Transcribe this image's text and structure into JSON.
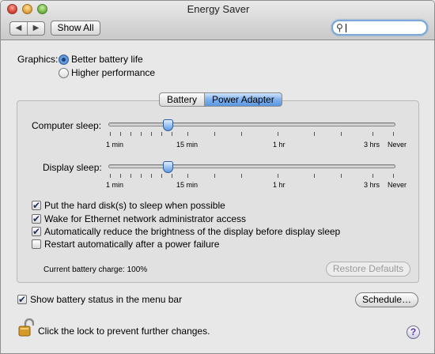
{
  "window": {
    "title": "Energy Saver"
  },
  "toolbar": {
    "back_icon": "back-arrow-icon",
    "forward_icon": "forward-arrow-icon",
    "back_glyph": "◀",
    "forward_glyph": "▶",
    "show_all_label": "Show All",
    "search_placeholder": "",
    "search_value": "",
    "search_icon": "magnifying-glass-icon",
    "search_glyph": "⚲"
  },
  "graphics": {
    "label": "Graphics:",
    "options": [
      {
        "label": "Better battery life",
        "selected": true
      },
      {
        "label": "Higher performance",
        "selected": false
      }
    ]
  },
  "tabs": [
    {
      "label": "Battery",
      "active": false
    },
    {
      "label": "Power Adapter",
      "active": true
    }
  ],
  "computer_sleep": {
    "label": "Computer sleep:",
    "value": "15 min"
  },
  "display_sleep": {
    "label": "Display sleep:",
    "value": "15 min"
  },
  "tick_labels": [
    "1 min",
    "15 min",
    "1 hr",
    "3 hrs",
    "Never"
  ],
  "checkboxes": [
    {
      "label": "Put the hard disk(s) to sleep when possible",
      "checked": true
    },
    {
      "label": "Wake for Ethernet network administrator access",
      "checked": true
    },
    {
      "label": "Automatically reduce the brightness of the display before display sleep",
      "checked": true
    },
    {
      "label": "Restart automatically after a power failure",
      "checked": false
    }
  ],
  "battery_charge": "Current battery charge: 100%",
  "restore_defaults_label": "Restore Defaults",
  "show_battery_status": {
    "label": "Show battery status in the menu bar",
    "checked": true
  },
  "schedule_label": "Schedule…",
  "lock": {
    "text": "Click the lock to prevent further changes.",
    "icon": "open-lock-icon"
  },
  "help": {
    "icon": "help-icon",
    "glyph": "?"
  },
  "check_glyph": "✔"
}
